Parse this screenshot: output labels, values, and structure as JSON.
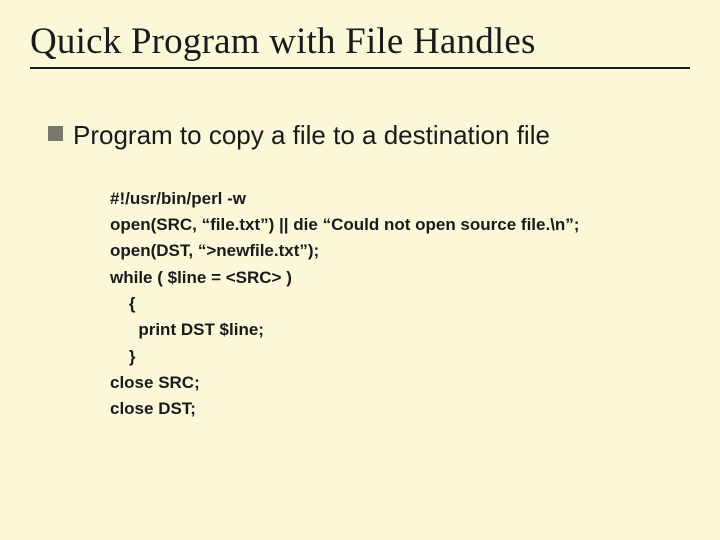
{
  "title": "Quick Program with File Handles",
  "bullet": "Program to copy a file to a destination file",
  "code": {
    "l1": "#!/usr/bin/perl -w",
    "l2": "open(SRC, “file.txt”) || die “Could not open source file.\\n”;",
    "l3": "open(DST, “>newfile.txt”);",
    "l4": "while ( $line = <SRC> )",
    "l5": "    {",
    "l6": "      print DST $line;",
    "l7": "    }",
    "l8": "close SRC;",
    "l9": "close DST;"
  }
}
